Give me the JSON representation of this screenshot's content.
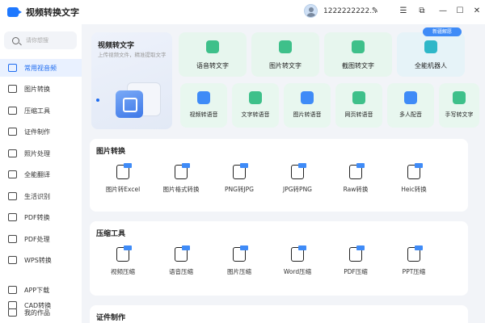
{
  "app": {
    "title": "视频转换文字"
  },
  "titlebar": {
    "user_phone": "1222222222..."
  },
  "sidebar": {
    "search_placeholder": "请你想搜",
    "items": [
      {
        "label": "常用视音频",
        "icon": "video-icon",
        "active": true
      },
      {
        "label": "图片转换",
        "icon": "image-icon"
      },
      {
        "label": "压缩工具",
        "icon": "compress-icon"
      },
      {
        "label": "证件制作",
        "icon": "id-card-icon"
      },
      {
        "label": "照片处理",
        "icon": "photo-icon"
      },
      {
        "label": "全能翻译",
        "icon": "translate-icon"
      },
      {
        "label": "生活识别",
        "icon": "cup-icon"
      },
      {
        "label": "PDF转换",
        "icon": "pdf-icon"
      },
      {
        "label": "PDF处理",
        "icon": "pdf-edit-icon"
      },
      {
        "label": "WPS转换",
        "icon": "wps-icon"
      },
      {
        "label": "CAD转换",
        "icon": "cad-icon"
      },
      {
        "label": "APP下载",
        "icon": "phone-icon"
      },
      {
        "label": "我的作品",
        "icon": "folder-icon"
      }
    ]
  },
  "hero": {
    "title": "视频转文字",
    "desc": "上传视频文件，精准提取文字"
  },
  "top_cards": [
    {
      "label": "语音转文字",
      "icon": "mic-icon",
      "color": "#3ec08a"
    },
    {
      "label": "图片转文字",
      "icon": "image-text-icon",
      "color": "#3ec08a"
    },
    {
      "label": "截图转文字",
      "icon": "screenshot-icon",
      "color": "#3ec08a"
    },
    {
      "label": "全能机器人",
      "icon": "robot-icon",
      "color": "#2fb7c8",
      "badge": "新疆解愿"
    }
  ],
  "small_cards": [
    {
      "label": "视频转语音",
      "icon": "video-to-audio-icon",
      "color": "#3f8bf7"
    },
    {
      "label": "文字转语音",
      "icon": "text-to-audio-icon",
      "color": "#3ec08a"
    },
    {
      "label": "图片转语音",
      "icon": "image-to-audio-icon",
      "color": "#3f8bf7"
    },
    {
      "label": "网页转语音",
      "icon": "web-to-audio-icon",
      "color": "#3ec08a"
    },
    {
      "label": "多人配音",
      "icon": "dubbing-icon",
      "color": "#3f8bf7"
    },
    {
      "label": "手写转文字",
      "icon": "handwriting-icon",
      "color": "#3ec08a"
    }
  ],
  "sections": [
    {
      "title": "图片转换",
      "tools": [
        {
          "label": "图片转Excel",
          "icon": "image-excel-icon"
        },
        {
          "label": "图片格式转换",
          "icon": "image-format-icon"
        },
        {
          "label": "PNG转JPG",
          "icon": "png-jpg-icon"
        },
        {
          "label": "JPG转PNG",
          "icon": "jpg-png-icon"
        },
        {
          "label": "Raw转换",
          "icon": "raw-icon"
        },
        {
          "label": "Heic转换",
          "icon": "heic-icon"
        }
      ]
    },
    {
      "title": "压缩工具",
      "tools": [
        {
          "label": "视频压缩",
          "icon": "video-zip-icon"
        },
        {
          "label": "语音压缩",
          "icon": "audio-zip-icon"
        },
        {
          "label": "图片压缩",
          "icon": "image-zip-icon"
        },
        {
          "label": "Word压缩",
          "icon": "word-zip-icon"
        },
        {
          "label": "PDF压缩",
          "icon": "pdf-zip-icon"
        },
        {
          "label": "PPT压缩",
          "icon": "ppt-zip-icon"
        }
      ]
    },
    {
      "title": "证件制作",
      "tools": []
    }
  ]
}
